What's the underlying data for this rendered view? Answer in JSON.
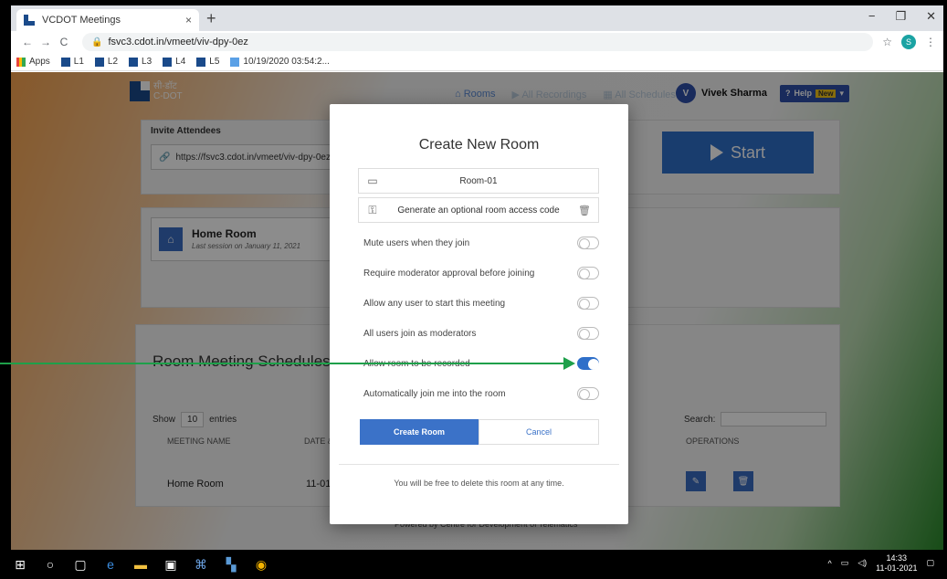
{
  "browser": {
    "tab_title": "VCDOT Meetings",
    "tab_close": "×",
    "new_tab": "+",
    "url": "fsvc3.cdot.in/vmeet/viv-dpy-0ez",
    "profile_initial": "S",
    "window_controls": [
      "−",
      "❐",
      "✕"
    ],
    "bookmarks": [
      "Apps",
      "L1",
      "L2",
      "L3",
      "L4",
      "L5",
      "10/19/2020 03:54:2..."
    ]
  },
  "navbar": {
    "brand_hindi": "सी-डॉट",
    "brand": "C-DOT",
    "links": [
      "Rooms",
      "All Recordings",
      "All Schedules"
    ],
    "user_initial": "V",
    "user_name": "Vivek Sharma",
    "help_label": "Help",
    "help_badge": "New"
  },
  "invite": {
    "label": "Invite Attendees",
    "url": "https://fsvc3.cdot.in/vmeet/viv-dpy-0ez",
    "start_label": "Start"
  },
  "home_room": {
    "title": "Home Room",
    "subtitle": "Last session on January 11, 2021"
  },
  "schedules": {
    "title": "Room Meeting Schedules",
    "show_label": "Show",
    "show_value": "10",
    "entries_label": "entries",
    "search_label": "Search:",
    "columns": [
      "MEETING NAME",
      "DATE & TI",
      "OPERATIONS"
    ],
    "row": {
      "name": "Home Room",
      "date": "11-01-20"
    }
  },
  "footer_text": "Powered by Centre for Development of Telematics",
  "modal": {
    "title": "Create New Room",
    "room_name": "Room-01",
    "access_code": "Generate an optional room access code",
    "toggles": [
      {
        "label": "Mute users when they join",
        "on": false
      },
      {
        "label": "Require moderator approval before joining",
        "on": false
      },
      {
        "label": "Allow any user to start this meeting",
        "on": false
      },
      {
        "label": "All users join as moderators",
        "on": false
      },
      {
        "label": "Allow room to be recorded",
        "on": true
      },
      {
        "label": "Automatically join me into the room",
        "on": false
      }
    ],
    "create_label": "Create Room",
    "cancel_label": "Cancel",
    "footer": "You will be free to delete this room at any time."
  },
  "taskbar": {
    "time": "14:33",
    "date": "11-01-2021"
  },
  "colors": {
    "accent": "#3b72c8",
    "arrow": "#1ea04a"
  }
}
